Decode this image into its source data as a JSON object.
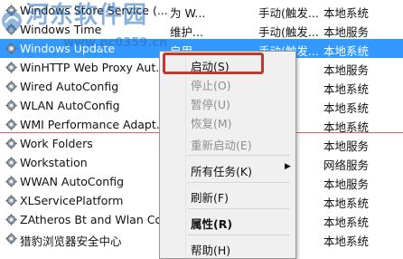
{
  "watermark": {
    "text": "河东软件园",
    "url": "www.pc0359.cn"
  },
  "services": [
    {
      "name": "Windows Store Service (...",
      "desc": "为 W...",
      "start": "手动(触发...",
      "logon": "本地系统"
    },
    {
      "name": "Windows Time",
      "desc": "维护...",
      "start": "手动(触发...",
      "logon": "本地服务"
    },
    {
      "name": "Windows Update",
      "desc": "启用...",
      "start": "手动(触发...",
      "logon": "本地系统"
    },
    {
      "name": "WinHTTP Web Proxy Aut...",
      "desc": "",
      "start": "",
      "logon": "本地服务"
    },
    {
      "name": "Wired AutoConfig",
      "desc": "",
      "start": "",
      "logon": "本地系统"
    },
    {
      "name": "WLAN AutoConfig",
      "desc": "",
      "start": "",
      "logon": "本地系统"
    },
    {
      "name": "WMI Performance Adapt...",
      "desc": "",
      "start": "",
      "logon": "本地系统"
    },
    {
      "name": "Work Folders",
      "desc": "",
      "start": "",
      "logon": "本地服务"
    },
    {
      "name": "Workstation",
      "desc": "",
      "start": "",
      "logon": "网络服务"
    },
    {
      "name": "WWAN AutoConfig",
      "desc": "",
      "start": "",
      "logon": "本地服务"
    },
    {
      "name": "XLServicePlatform",
      "desc": "",
      "start": "",
      "logon": "本地系统"
    },
    {
      "name": "ZAtheros Bt and Wlan Co...",
      "desc": "",
      "start": "",
      "logon": "本地系统"
    },
    {
      "name": "猎豹浏览器安全中心",
      "desc": "",
      "start": "",
      "logon": "本地系统"
    }
  ],
  "context_menu": {
    "start": "启动(S)",
    "stop": "停止(O)",
    "pause": "暂停(U)",
    "resume": "恢复(M)",
    "restart": "重新启动(E)",
    "all_tasks": "所有任务(K)",
    "refresh": "刷新(F)",
    "properties": "属性(R)",
    "help": "帮助(H)"
  },
  "colors": {
    "selection": "#3399ff",
    "highlight_box": "#c0392b"
  }
}
